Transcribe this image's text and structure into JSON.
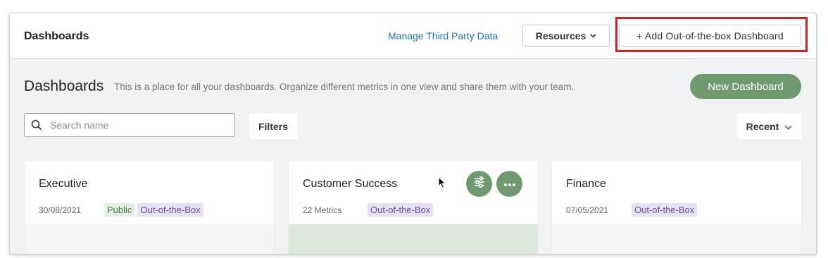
{
  "topbar": {
    "title": "Dashboards",
    "manage_link": "Manage Third Party Data",
    "resources_label": "Resources",
    "add_label": "+ Add Out-of-the-box Dashboard"
  },
  "header": {
    "title": "Dashboards",
    "description": "This is a place for all your dashboards. Organize different metrics in one view and share them with your team.",
    "new_button": "New Dashboard"
  },
  "toolbar": {
    "search_placeholder": "Search name",
    "filters_label": "Filters",
    "sort_label": "Recent"
  },
  "cards": [
    {
      "name": "Executive",
      "meta": "30/08/2021",
      "tags": [
        "Public",
        "Out-of-the-Box"
      ]
    },
    {
      "name": "Customer Success",
      "meta": "22 Metrics",
      "tags": [
        "Out-of-the-Box"
      ]
    },
    {
      "name": "Finance",
      "meta": "07/05/2021",
      "tags": [
        "Out-of-the-Box"
      ]
    }
  ],
  "colors": {
    "accent_green": "#6f9a70",
    "link_blue": "#1a73c9",
    "highlight_red": "#d61f1f"
  },
  "icons": [
    "search-icon",
    "chevron-down-icon",
    "sliders-icon",
    "more-icon",
    "cursor-icon"
  ]
}
